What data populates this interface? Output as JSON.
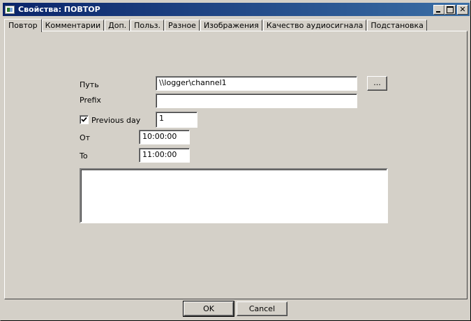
{
  "window": {
    "title": "Свойства: ПОВТОР",
    "controls": {
      "minimize_glyph": "",
      "maximize_glyph": "",
      "close_glyph": "✕"
    }
  },
  "tabs": [
    {
      "label": "Повтор",
      "active": true
    },
    {
      "label": "Комментарии",
      "active": false
    },
    {
      "label": "Доп.",
      "active": false
    },
    {
      "label": "Польз.",
      "active": false
    },
    {
      "label": "Разное",
      "active": false
    },
    {
      "label": "Изображения",
      "active": false
    },
    {
      "label": "Качество аудиосигнала",
      "active": false
    },
    {
      "label": "Подстановка",
      "active": false
    }
  ],
  "form": {
    "path_label": "Путь",
    "path_value": "\\\\logger\\channel1",
    "browse_label": "...",
    "prefix_label": "Prefix",
    "prefix_value": "",
    "previous_day_label": "Previous day",
    "previous_day_checked": true,
    "previous_day_value": "1",
    "from_label": "От",
    "from_value": "10:00:00",
    "to_label": "To",
    "to_value": "11:00:00",
    "notes_value": ""
  },
  "buttons": {
    "ok": "OK",
    "cancel": "Cancel"
  },
  "icons": {
    "app": "app-window-icon",
    "checkmark": "checkmark-icon"
  }
}
